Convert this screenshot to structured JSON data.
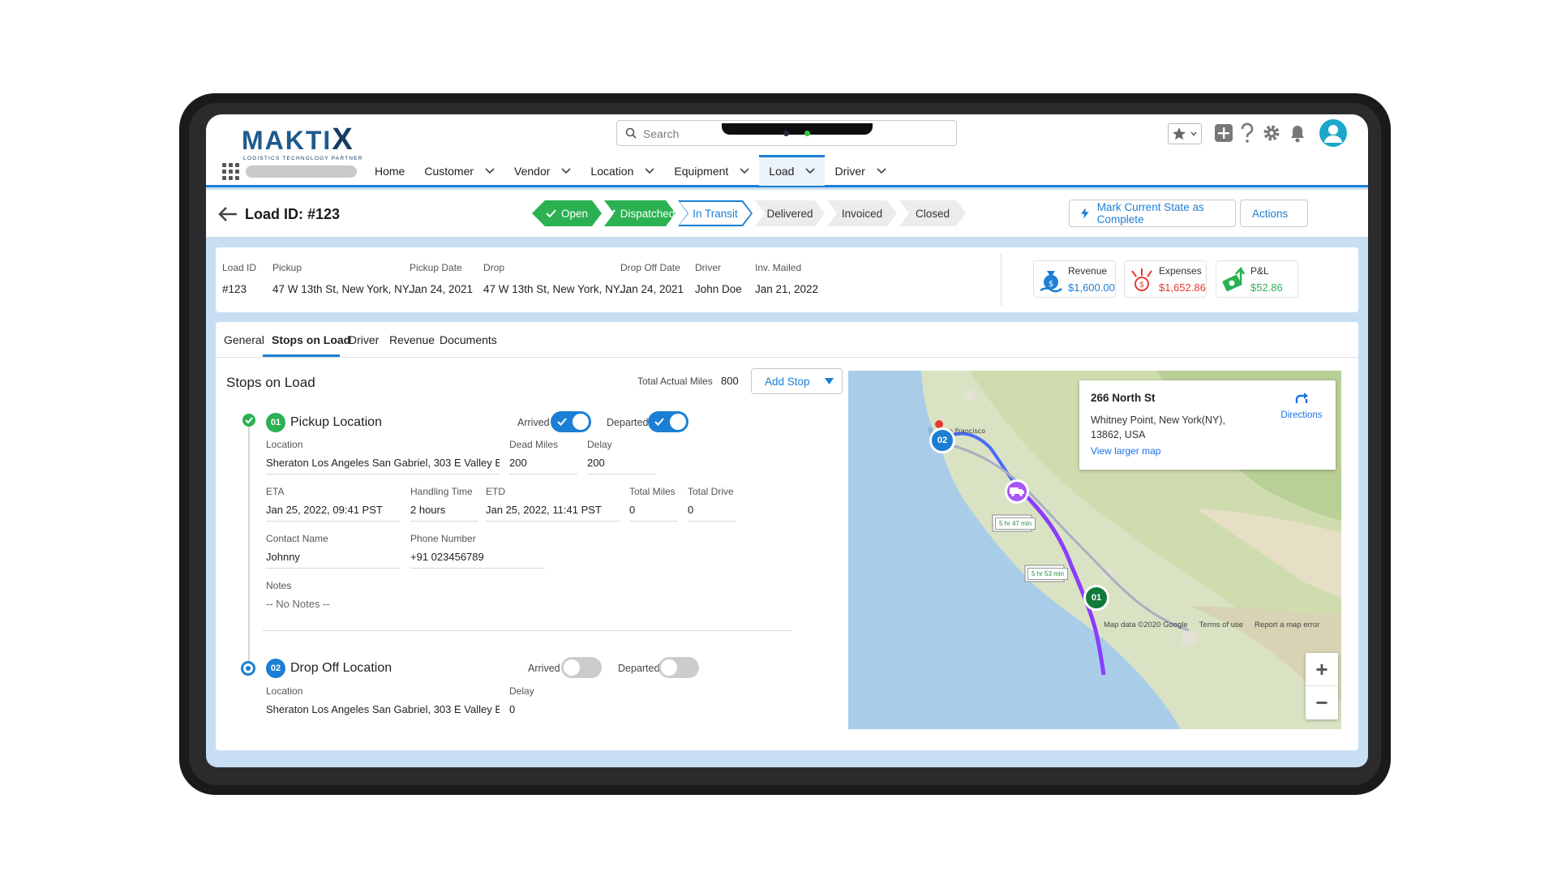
{
  "brand": {
    "name_main": "MAKTI",
    "name_x": "X",
    "tagline": "LOGISTICS TECHNOLOGY PARTNER"
  },
  "search": {
    "placeholder": "Search"
  },
  "nav": {
    "items": [
      {
        "label": "Home",
        "has_menu": false
      },
      {
        "label": "Customer",
        "has_menu": true
      },
      {
        "label": "Vendor",
        "has_menu": true
      },
      {
        "label": "Location",
        "has_menu": true
      },
      {
        "label": "Equipment",
        "has_menu": true
      },
      {
        "label": "Load",
        "has_menu": true,
        "active": true
      },
      {
        "label": "Driver",
        "has_menu": true
      }
    ]
  },
  "header": {
    "title": "Load ID: #123",
    "path": [
      {
        "label": "Open",
        "state": "done"
      },
      {
        "label": "Dispatched",
        "state": "done"
      },
      {
        "label": "In Transit",
        "state": "current"
      },
      {
        "label": "Delivered",
        "state": "todo"
      },
      {
        "label": "Invoiced",
        "state": "todo"
      },
      {
        "label": "Closed",
        "state": "todo"
      }
    ],
    "mark_complete_label": "Mark Current State as Complete",
    "actions_label": "Actions"
  },
  "summary": {
    "fields": [
      {
        "label": "Load ID",
        "value": "#123"
      },
      {
        "label": "Pickup",
        "value": "47 W 13th St, New York, NY..."
      },
      {
        "label": "Pickup Date",
        "value": "Jan 24, 2021"
      },
      {
        "label": "Drop",
        "value": "47 W 13th St, New York, NY..."
      },
      {
        "label": "Drop Off Date",
        "value": "Jan 24, 2021"
      },
      {
        "label": "Driver",
        "value": "John Doe"
      },
      {
        "label": "Inv. Mailed",
        "value": "Jan 21, 2022"
      }
    ],
    "kpis": {
      "revenue": {
        "label": "Revenue",
        "value": "$1,600.00",
        "color": "#1b7fd4"
      },
      "expenses": {
        "label": "Expenses",
        "value": "$1,652.86",
        "color": "#e53935"
      },
      "pnl": {
        "label": "P&L",
        "value": "$52.86",
        "color": "#2bb152"
      }
    }
  },
  "tabs": [
    {
      "label": "General"
    },
    {
      "label": "Stops on Load",
      "active": true
    },
    {
      "label": "Driver"
    },
    {
      "label": "Revenue"
    },
    {
      "label": "Documents"
    }
  ],
  "stops": {
    "section_title": "Stops on Load",
    "total_actual_miles_label": "Total Actual Miles",
    "total_actual_miles": "800",
    "add_stop_label": "Add Stop",
    "arrived_label": "Arrived",
    "departed_label": "Departed",
    "pickup": {
      "number": "01",
      "title": "Pickup Location",
      "arrived": true,
      "departed": true,
      "location_label": "Location",
      "location": "Sheraton Los Angeles San Gabriel, 303 E Valley Blv...",
      "dead_miles_label": "Dead Miles",
      "dead_miles": "200",
      "delay_label": "Delay",
      "delay": "200",
      "eta_label": "ETA",
      "eta": "Jan 25, 2022, 09:41 PST",
      "handling_label": "Handling Time",
      "handling": "2 hours",
      "etd_label": "ETD",
      "etd": "Jan 25, 2022, 11:41 PST",
      "total_miles_label": "Total Miles",
      "total_miles": "0",
      "total_drive_label": "Total Drive",
      "total_drive": "0",
      "contact_label": "Contact Name",
      "contact": "Johnny",
      "phone_label": "Phone  Number",
      "phone": "+91 023456789",
      "notes_label": "Notes",
      "notes": "-- No Notes --"
    },
    "dropoff": {
      "number": "02",
      "title": "Drop Off Location",
      "arrived": false,
      "departed": false,
      "location_label": "Location",
      "location": "Sheraton Los Angeles San Gabriel, 303 E Valley Blv...",
      "delay_label": "Delay",
      "delay": "0"
    }
  },
  "map": {
    "card_title": "266 North St",
    "card_line1": "Whitney Point, New York(NY),",
    "card_line2": "13862, USA",
    "larger_map": "View larger map",
    "directions": "Directions",
    "attribution": [
      "Map data ©2020 Google",
      "Terms of use",
      "Report a map error"
    ],
    "pin_01": "01",
    "pin_02": "02",
    "route_a": "5 hr 47 min",
    "route_b": "5 hr 53 min"
  },
  "colors": {
    "accent": "#1b7fd4",
    "done": "#2bb152",
    "route": "#a855f7"
  }
}
